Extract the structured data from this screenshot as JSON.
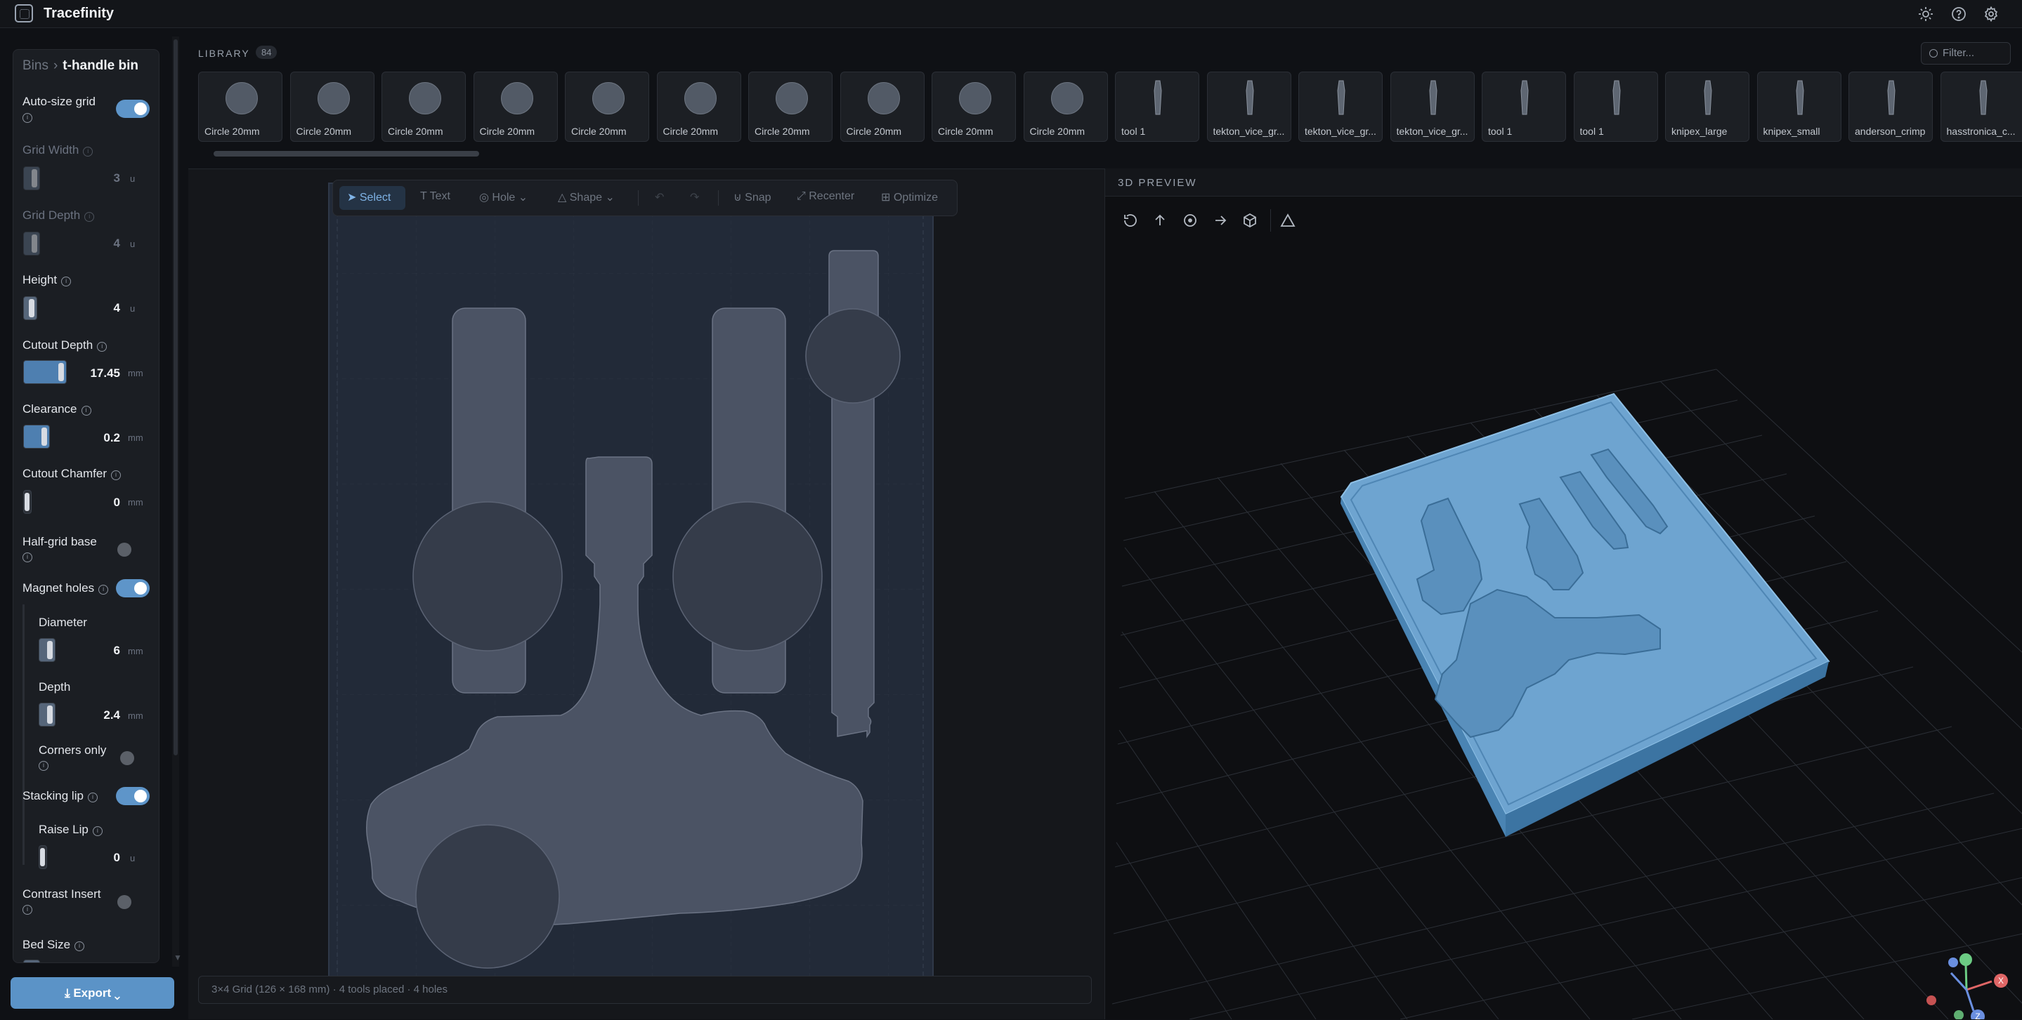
{
  "app": {
    "title": "Tracefinity"
  },
  "topbar": {
    "icons": [
      "sun-icon",
      "help-icon",
      "gear-icon"
    ]
  },
  "sidebar": {
    "breadcrumb": {
      "root": "Bins",
      "current": "t-handle bin"
    },
    "auto_size_grid": {
      "label": "Auto-size grid",
      "on": true
    },
    "grid_width": {
      "label": "Grid Width",
      "value": "3",
      "unit": "u"
    },
    "grid_depth": {
      "label": "Grid Depth",
      "value": "4",
      "unit": "u"
    },
    "height": {
      "label": "Height",
      "value": "4",
      "unit": "u"
    },
    "cutout_depth": {
      "label": "Cutout Depth",
      "value": "17.45",
      "unit": "mm"
    },
    "clearance": {
      "label": "Clearance",
      "value": "0.2",
      "unit": "mm"
    },
    "cutout_chamfer": {
      "label": "Cutout Chamfer",
      "value": "0",
      "unit": "mm"
    },
    "half_grid_base": {
      "label": "Half-grid base",
      "on": false
    },
    "magnet_holes": {
      "label": "Magnet holes",
      "on": true
    },
    "diameter": {
      "label": "Diameter",
      "value": "6",
      "unit": "mm"
    },
    "depth": {
      "label": "Depth",
      "value": "2.4",
      "unit": "mm"
    },
    "corners_only": {
      "label": "Corners only",
      "on": false
    },
    "stacking_lip": {
      "label": "Stacking lip",
      "on": true
    },
    "raise_lip": {
      "label": "Raise Lip",
      "value": "0",
      "unit": "u"
    },
    "contrast_insert": {
      "label": "Contrast Insert",
      "on": false
    },
    "bed_size": {
      "label": "Bed Size"
    },
    "export_label": "Export"
  },
  "library": {
    "title": "LIBRARY",
    "count": "84",
    "filter_placeholder": "Filter...",
    "items": [
      {
        "name": "Circle 20mm",
        "kind": "circle"
      },
      {
        "name": "Circle 20mm",
        "kind": "circle"
      },
      {
        "name": "Circle 20mm",
        "kind": "circle"
      },
      {
        "name": "Circle 20mm",
        "kind": "circle"
      },
      {
        "name": "Circle 20mm",
        "kind": "circle"
      },
      {
        "name": "Circle 20mm",
        "kind": "circle"
      },
      {
        "name": "Circle 20mm",
        "kind": "circle"
      },
      {
        "name": "Circle 20mm",
        "kind": "circle"
      },
      {
        "name": "Circle 20mm",
        "kind": "circle"
      },
      {
        "name": "Circle 20mm",
        "kind": "circle"
      },
      {
        "name": "tool 1",
        "kind": "tool"
      },
      {
        "name": "tekton_vice_gr...",
        "kind": "tool"
      },
      {
        "name": "tekton_vice_gr...",
        "kind": "tool"
      },
      {
        "name": "tekton_vice_gr...",
        "kind": "tool"
      },
      {
        "name": "tool 1",
        "kind": "tool"
      },
      {
        "name": "tool 1",
        "kind": "tool"
      },
      {
        "name": "knipex_large",
        "kind": "tool"
      },
      {
        "name": "knipex_small",
        "kind": "tool"
      },
      {
        "name": "anderson_crimp",
        "kind": "tool"
      },
      {
        "name": "hasstronica_c...",
        "kind": "tool"
      }
    ]
  },
  "toolbar": {
    "select": "Select",
    "text": "Text",
    "hole": "Hole",
    "shape": "Shape",
    "snap": "Snap",
    "recenter": "Recenter",
    "optimize": "Optimize"
  },
  "status": {
    "text": "3×4 Grid (126 × 168 mm) · 4 tools placed · 4 holes"
  },
  "preview": {
    "title": "3D PREVIEW",
    "icons": [
      "reset-view-icon",
      "top-view-icon",
      "front-view-icon",
      "side-view-icon",
      "iso-view-icon",
      "wireframe-icon"
    ],
    "bin_color": "#6ea4d0",
    "axis_labels": {
      "x": "X",
      "z": "Z"
    }
  },
  "colors": {
    "accent": "#5b93c7",
    "canvas_bin": "#222a38",
    "tool_fill": "#4b5364",
    "hole_fill": "#353c4a"
  }
}
